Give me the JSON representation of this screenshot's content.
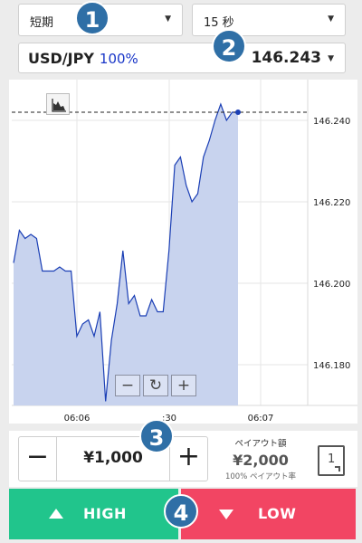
{
  "controls": {
    "option_type": "短期",
    "duration": "15 秒",
    "pair": "USD/JPY",
    "pair_payout_pct": "100%",
    "current_price": "146.243"
  },
  "badges": [
    "1",
    "2",
    "3",
    "4"
  ],
  "chart_data": {
    "type": "area",
    "title": "",
    "y_ticks": [
      "146.240",
      "146.220",
      "146.200",
      "146.180"
    ],
    "x_ticks": [
      "06:06",
      ":30",
      "06:07"
    ],
    "ylim": [
      146.17,
      146.25
    ],
    "current_level": 146.242,
    "grid": true,
    "colors": {
      "line": "#1b3fb5",
      "fill": "#c8d3ee",
      "current_dot": "#1b3fb5"
    },
    "values": [
      146.205,
      146.213,
      146.211,
      146.212,
      146.211,
      146.203,
      146.203,
      146.203,
      146.204,
      146.203,
      146.203,
      146.187,
      146.19,
      146.191,
      146.187,
      146.193,
      146.171,
      146.186,
      146.195,
      146.208,
      146.195,
      146.197,
      146.192,
      146.192,
      146.196,
      146.193,
      146.193,
      146.208,
      146.229,
      146.231,
      146.224,
      146.22,
      146.222,
      146.231,
      146.235,
      146.24,
      146.244,
      146.24,
      146.242,
      146.242
    ]
  },
  "zoom_controls": {
    "zoom_out": "−",
    "reset": "↻",
    "zoom_in": "+"
  },
  "trade": {
    "minus": "−",
    "plus": "+",
    "amount": "¥1,000",
    "payout_label": "ペイアウト額",
    "payout_value": "¥2,000",
    "payout_rate": "100% ペイアウト率",
    "one_click": "1"
  },
  "actions": {
    "high": "HIGH",
    "low": "LOW"
  }
}
